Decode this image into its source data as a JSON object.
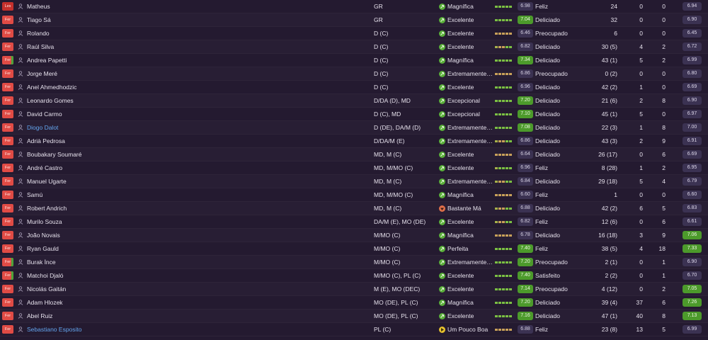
{
  "colors": {
    "background": "#241a30",
    "form_green": "#7bc043",
    "form_olive": "#a7b24a",
    "form_tan": "#c9a15a",
    "badge_green": "#4c9a2b",
    "badge_grey": "#3b3252",
    "link": "#63a5ee",
    "status_red": "#e04b45"
  },
  "players": [
    {
      "status": "Les",
      "name": "Matheus",
      "pos": "GR",
      "cond": "Magnífica",
      "cond_level": "good",
      "form": [
        "g",
        "g",
        "g",
        "g",
        "g"
      ],
      "score": "6.98",
      "score_good": false,
      "moral": "Feliz",
      "apps": "24",
      "goals": "0",
      "assists": "0",
      "rating": "6.94",
      "rating_good": false
    },
    {
      "status": "Fer",
      "name": "Tiago Sá",
      "pos": "GR",
      "cond": "Excelente",
      "cond_level": "good",
      "form": [
        "g",
        "g",
        "g",
        "g",
        "g"
      ],
      "score": "7.04",
      "score_good": true,
      "moral": "Deliciado",
      "apps": "32",
      "goals": "0",
      "assists": "0",
      "rating": "6.90",
      "rating_good": false
    },
    {
      "status": "Fer",
      "name": "Rolando",
      "pos": "D (C)",
      "cond": "Excelente",
      "cond_level": "good",
      "form": [
        "t",
        "t",
        "t",
        "t",
        "t"
      ],
      "score": "6.46",
      "score_good": false,
      "moral": "Preocupado",
      "apps": "6",
      "goals": "0",
      "assists": "0",
      "rating": "6.45",
      "rating_good": false
    },
    {
      "status": "Fer",
      "name": "Raúl Silva",
      "pos": "D (C)",
      "cond": "Excelente",
      "cond_level": "good",
      "form": [
        "o",
        "t",
        "t",
        "g",
        "g"
      ],
      "score": "6.82",
      "score_good": false,
      "moral": "Deliciado",
      "apps": "30 (5)",
      "goals": "4",
      "assists": "2",
      "rating": "6.72",
      "rating_good": false
    },
    {
      "status": "Fer",
      "name": "Andrea Papetti",
      "pos": "D (C)",
      "cond": "Magnífica",
      "cond_level": "good",
      "form": [
        "g",
        "g",
        "g",
        "g",
        "g"
      ],
      "score": "7.34",
      "score_good": true,
      "moral": "Deliciado",
      "apps": "43 (1)",
      "goals": "5",
      "assists": "2",
      "rating": "6.99",
      "rating_good": false,
      "status_green": true
    },
    {
      "status": "Fer",
      "name": "Jorge Meré",
      "pos": "D (C)",
      "cond": "Extremamente…",
      "cond_level": "good",
      "form": [
        "t",
        "t",
        "t",
        "t",
        "t"
      ],
      "score": "6.86",
      "score_good": false,
      "moral": "Preocupado",
      "apps": "0 (2)",
      "goals": "0",
      "assists": "0",
      "rating": "6.80",
      "rating_good": false
    },
    {
      "status": "Fer",
      "name": "Anel Ahmedhodzic",
      "pos": "D (C)",
      "cond": "Excelente",
      "cond_level": "good",
      "form": [
        "g",
        "g",
        "g",
        "g",
        "g"
      ],
      "score": "6.96",
      "score_good": false,
      "moral": "Deliciado",
      "apps": "42 (2)",
      "goals": "1",
      "assists": "0",
      "rating": "6.69",
      "rating_good": false
    },
    {
      "status": "Fer",
      "name": "Leonardo Gomes",
      "pos": "D/DA (D), MD",
      "cond": "Excepcional",
      "cond_level": "good",
      "form": [
        "g",
        "g",
        "g",
        "g",
        "g"
      ],
      "score": "7.20",
      "score_good": true,
      "moral": "Deliciado",
      "apps": "21 (6)",
      "goals": "2",
      "assists": "8",
      "rating": "6.90",
      "rating_good": false
    },
    {
      "status": "Fer",
      "name": "David Carmo",
      "pos": "D (C), MD",
      "cond": "Excepcional",
      "cond_level": "good",
      "form": [
        "g",
        "g",
        "g",
        "g",
        "g"
      ],
      "score": "7.10",
      "score_good": true,
      "moral": "Deliciado",
      "apps": "45 (1)",
      "goals": "5",
      "assists": "0",
      "rating": "6.97",
      "rating_good": false
    },
    {
      "status": "Fer",
      "name": "Diogo Dalot",
      "pos": "D (DE), DA/M (D)",
      "cond": "Extremamente…",
      "cond_level": "good",
      "form": [
        "g",
        "g",
        "g",
        "g",
        "g"
      ],
      "score": "7.08",
      "score_good": true,
      "moral": "Deliciado",
      "apps": "22 (3)",
      "goals": "1",
      "assists": "8",
      "rating": "7.00",
      "rating_good": false,
      "link": true
    },
    {
      "status": "Fer",
      "name": "Adrià Pedrosa",
      "pos": "D/DA/M (E)",
      "cond": "Extremamente…",
      "cond_level": "good",
      "form": [
        "o",
        "t",
        "t",
        "g",
        "g"
      ],
      "score": "6.86",
      "score_good": false,
      "moral": "Deliciado",
      "apps": "43 (3)",
      "goals": "2",
      "assists": "9",
      "rating": "6.91",
      "rating_good": false
    },
    {
      "status": "Fer",
      "name": "Boubakary Soumaré",
      "pos": "MD, M (C)",
      "cond": "Excelente",
      "cond_level": "good",
      "form": [
        "t",
        "t",
        "t",
        "t",
        "t"
      ],
      "score": "6.64",
      "score_good": false,
      "moral": "Deliciado",
      "apps": "26 (17)",
      "goals": "0",
      "assists": "6",
      "rating": "6.69",
      "rating_good": false
    },
    {
      "status": "Fer",
      "name": "André Castro",
      "pos": "MD, M/MO (C)",
      "cond": "Excelente",
      "cond_level": "good",
      "form": [
        "o",
        "g",
        "g",
        "g",
        "g"
      ],
      "score": "6.96",
      "score_good": false,
      "moral": "Feliz",
      "apps": "8 (28)",
      "goals": "1",
      "assists": "2",
      "rating": "6.95",
      "rating_good": false
    },
    {
      "status": "Fer",
      "name": "Manuel Ugarte",
      "pos": "MD, M (C)",
      "cond": "Extremamente…",
      "cond_level": "good",
      "form": [
        "o",
        "t",
        "t",
        "g",
        "g"
      ],
      "score": "6.84",
      "score_good": false,
      "moral": "Deliciado",
      "apps": "29 (18)",
      "goals": "5",
      "assists": "4",
      "rating": "6.79",
      "rating_good": false
    },
    {
      "status": "Fer",
      "name": "Samú",
      "pos": "MD, M/MO (C)",
      "cond": "Magnífica",
      "cond_level": "good",
      "form": [
        "t",
        "t",
        "t",
        "t",
        "t"
      ],
      "score": "6.60",
      "score_good": false,
      "moral": "Feliz",
      "apps": "1",
      "goals": "0",
      "assists": "0",
      "rating": "6.60",
      "rating_good": false
    },
    {
      "status": "Fer",
      "name": "Robert Andrich",
      "pos": "MD, M (C)",
      "cond": "Bastante Má",
      "cond_level": "bad",
      "form": [
        "o",
        "t",
        "t",
        "g",
        "g"
      ],
      "score": "6.88",
      "score_good": false,
      "moral": "Deliciado",
      "apps": "42 (2)",
      "goals": "6",
      "assists": "5",
      "rating": "6.83",
      "rating_good": false
    },
    {
      "status": "Fer",
      "name": "Murilo Souza",
      "pos": "DA/M (E), MO (DE)",
      "cond": "Excelente",
      "cond_level": "good",
      "form": [
        "o",
        "t",
        "t",
        "g",
        "g"
      ],
      "score": "6.82",
      "score_good": false,
      "moral": "Feliz",
      "apps": "12 (6)",
      "goals": "0",
      "assists": "6",
      "rating": "6.61",
      "rating_good": false
    },
    {
      "status": "Fer",
      "name": "João Novais",
      "pos": "M/MO (C)",
      "cond": "Magnífica",
      "cond_level": "good",
      "form": [
        "t",
        "t",
        "t",
        "t",
        "t"
      ],
      "score": "6.78",
      "score_good": false,
      "moral": "Deliciado",
      "apps": "16 (18)",
      "goals": "3",
      "assists": "9",
      "rating": "7.06",
      "rating_good": true
    },
    {
      "status": "Fer",
      "name": "Ryan Gauld",
      "pos": "M/MO (C)",
      "cond": "Perfeita",
      "cond_level": "good",
      "form": [
        "g",
        "g",
        "g",
        "g",
        "g"
      ],
      "score": "7.40",
      "score_good": true,
      "moral": "Feliz",
      "apps": "38 (5)",
      "goals": "4",
      "assists": "18",
      "rating": "7.33",
      "rating_good": true
    },
    {
      "status": "Fer",
      "name": "Burak İnce",
      "pos": "M/MO (C)",
      "cond": "Extremamente…",
      "cond_level": "good",
      "form": [
        "g",
        "g",
        "g",
        "g",
        "g"
      ],
      "score": "7.20",
      "score_good": true,
      "moral": "Preocupado",
      "apps": "2 (1)",
      "goals": "0",
      "assists": "1",
      "rating": "6.90",
      "rating_good": false,
      "status_green": true
    },
    {
      "status": "Fer",
      "name": "Matchoi Djaló",
      "pos": "M/MO (C), PL (C)",
      "cond": "Excelente",
      "cond_level": "good",
      "form": [
        "g",
        "g",
        "g",
        "g",
        "g"
      ],
      "score": "7.40",
      "score_good": true,
      "moral": "Satisfeito",
      "apps": "2 (2)",
      "goals": "0",
      "assists": "1",
      "rating": "6.70",
      "rating_good": false,
      "status_green": true
    },
    {
      "status": "Fer",
      "name": "Nicolás Gaitán",
      "pos": "M (E), MO (DEC)",
      "cond": "Excelente",
      "cond_level": "good",
      "form": [
        "g",
        "g",
        "g",
        "g",
        "g"
      ],
      "score": "7.14",
      "score_good": true,
      "moral": "Preocupado",
      "apps": "4 (12)",
      "goals": "0",
      "assists": "2",
      "rating": "7.05",
      "rating_good": true
    },
    {
      "status": "Fer",
      "name": "Adam Hlozek",
      "pos": "MO (DE), PL (C)",
      "cond": "Magnífica",
      "cond_level": "good",
      "form": [
        "g",
        "g",
        "g",
        "g",
        "g"
      ],
      "score": "7.20",
      "score_good": true,
      "moral": "Deliciado",
      "apps": "39 (4)",
      "goals": "37",
      "assists": "6",
      "rating": "7.26",
      "rating_good": true
    },
    {
      "status": "Fer",
      "name": "Abel Ruiz",
      "pos": "MO (DE), PL (C)",
      "cond": "Excelente",
      "cond_level": "good",
      "form": [
        "g",
        "g",
        "g",
        "g",
        "g"
      ],
      "score": "7.16",
      "score_good": true,
      "moral": "Deliciado",
      "apps": "47 (1)",
      "goals": "40",
      "assists": "8",
      "rating": "7.13",
      "rating_good": true
    },
    {
      "status": "Fer",
      "name": "Sebastiano Esposito",
      "pos": "PL (C)",
      "cond": "Um Pouco Boa",
      "cond_level": "mid",
      "form": [
        "t",
        "t",
        "t",
        "t",
        "t"
      ],
      "score": "6.88",
      "score_good": false,
      "moral": "Feliz",
      "apps": "23 (8)",
      "goals": "13",
      "assists": "5",
      "rating": "6.99",
      "rating_good": false,
      "link": true
    }
  ]
}
